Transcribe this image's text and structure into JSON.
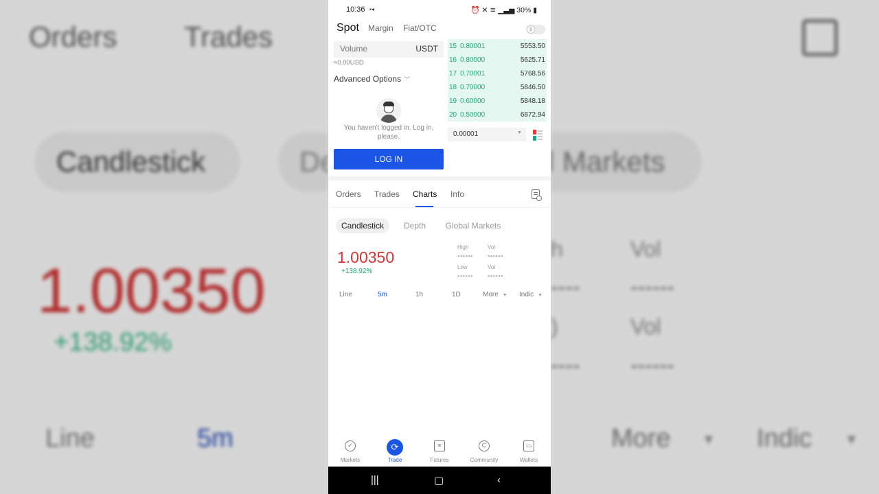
{
  "status_bar": {
    "time": "10:36",
    "battery": "30%",
    "icons": [
      "video-icon",
      "alarm-icon",
      "mute-icon",
      "wifi-icon",
      "signal-icon",
      "battery-icon"
    ]
  },
  "header": {
    "tabs": [
      "Spot",
      "Margin",
      "Fiat/OTC"
    ],
    "active_tab": "Spot",
    "toggle_icon_text": "$"
  },
  "order_form": {
    "volume_label": "Volume",
    "volume_unit": "USDT",
    "approx": "≈0.00USD",
    "advanced_options": "Advanced Options",
    "login_message": "You haven't logged in. Log in, please.",
    "login_button": "LOG IN"
  },
  "orderbook": {
    "rows": [
      {
        "idx": "15",
        "price": "0.80001",
        "amount": "5553.50"
      },
      {
        "idx": "16",
        "price": "0.80000",
        "amount": "5625.71"
      },
      {
        "idx": "17",
        "price": "0.70001",
        "amount": "5768.56"
      },
      {
        "idx": "18",
        "price": "0.70000",
        "amount": "5846.50"
      },
      {
        "idx": "19",
        "price": "0.60000",
        "amount": "5848.18"
      },
      {
        "idx": "20",
        "price": "0.50000",
        "amount": "6872.94"
      }
    ],
    "precision": "0.00001"
  },
  "section_tabs": {
    "items": [
      "Orders",
      "Trades",
      "Charts",
      "Info"
    ],
    "active": "Charts"
  },
  "chart_types": {
    "items": [
      "Candlestick",
      "Depth",
      "Global Markets"
    ],
    "active": "Candlestick"
  },
  "ticker": {
    "price": "1.00350",
    "change": "+138.92%",
    "high_label": "High",
    "high_value": "------",
    "vol1_label": "Vol",
    "vol1_value": "------",
    "low_label": "Low",
    "low_value": "------",
    "vol2_label": "Vol",
    "vol2_value": "------"
  },
  "intervals": {
    "items": [
      "Line",
      "5m",
      "1h",
      "1D",
      "More",
      "Indic"
    ],
    "active": "5m"
  },
  "bottom_nav": {
    "items": [
      "Markets",
      "Trade",
      "Futures",
      "Community",
      "Wallets"
    ],
    "active": "Trade"
  },
  "colors": {
    "accent": "#1a55e6",
    "down": "#d63636",
    "up": "#21a87a",
    "orderbook_bg": "#e4f7f1"
  }
}
